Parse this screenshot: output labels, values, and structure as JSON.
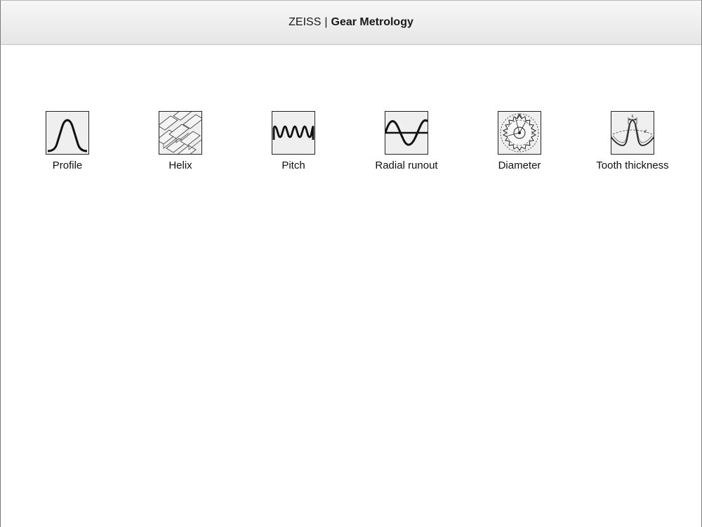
{
  "header": {
    "brand": "ZEISS",
    "separator": "|",
    "app_name": "Gear Metrology"
  },
  "tiles": [
    {
      "label": "Profile",
      "icon": "profile-icon"
    },
    {
      "label": "Helix",
      "icon": "helix-icon"
    },
    {
      "label": "Pitch",
      "icon": "pitch-icon"
    },
    {
      "label": "Radial runout",
      "icon": "radial-runout-icon"
    },
    {
      "label": "Diameter",
      "icon": "diameter-icon"
    },
    {
      "label": "Tooth thickness",
      "icon": "tooth-thickness-icon"
    }
  ]
}
